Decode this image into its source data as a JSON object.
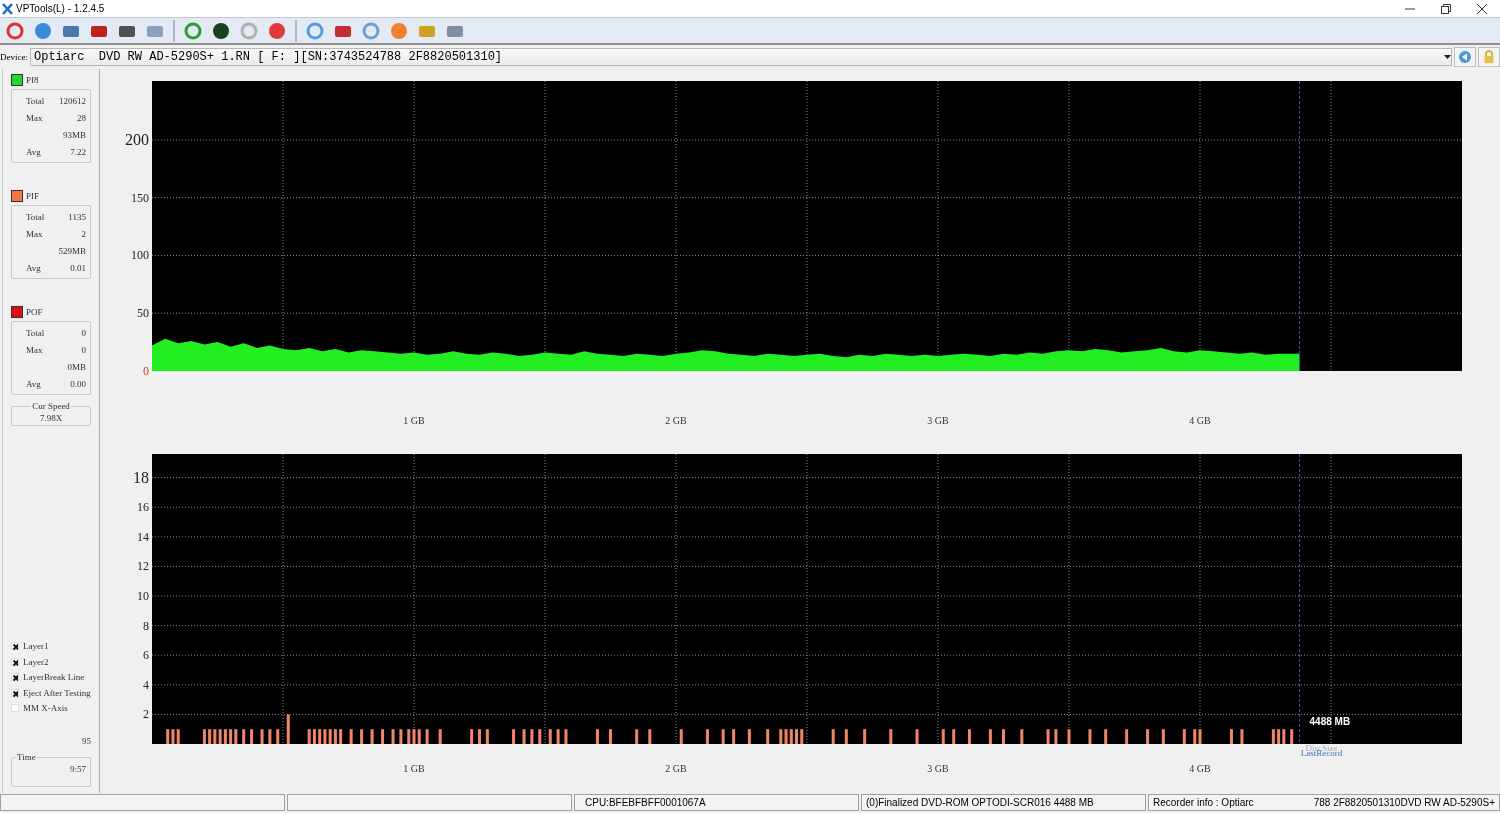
{
  "window": {
    "title": "VPTools(L) - 1.2.4.5"
  },
  "device": {
    "label": "Device:",
    "value": "Optiarc  DVD RW AD-5290S+ 1.RN [ F: ][SN:3743524788 2F8820501310]"
  },
  "stats": [
    {
      "name": "PI8",
      "color": "#22dd22",
      "rows": [
        {
          "label": "Total",
          "value": "120612"
        },
        {
          "label": "Max",
          "value": "28"
        },
        {
          "value": "93MB"
        },
        {
          "label": "Avg",
          "value": "7.22"
        }
      ]
    },
    {
      "name": "PIF",
      "color": "#f07840",
      "rows": [
        {
          "label": "Total",
          "value": "1135"
        },
        {
          "label": "Max",
          "value": "2"
        },
        {
          "value": "529MB"
        },
        {
          "label": "Avg",
          "value": "0.01"
        }
      ]
    },
    {
      "name": "POF",
      "color": "#dd1111",
      "rows": [
        {
          "label": "Total",
          "value": "0"
        },
        {
          "label": "Max",
          "value": "0"
        },
        {
          "value": "0MB"
        },
        {
          "label": "Avg",
          "value": "0.00"
        }
      ]
    }
  ],
  "cur_speed": {
    "label": "Cur Speed",
    "value": "7.98X"
  },
  "options": [
    {
      "label": "Layer1",
      "checked": true
    },
    {
      "label": "Layer2",
      "checked": true
    },
    {
      "label": "LayerBreak Line",
      "checked": true
    },
    {
      "label": "Eject After Testing",
      "checked": true
    },
    {
      "label": "MM X-Axis",
      "checked": false
    }
  ],
  "count": "95",
  "time": {
    "label": "Time",
    "value": "9:57"
  },
  "charts": [
    {
      "chart_data": {
        "type": "area",
        "xlim": [
          0,
          5
        ],
        "ylim": [
          0,
          251
        ],
        "xticks": [
          {
            "value": 1,
            "label": "1 GB"
          },
          {
            "value": 2,
            "label": "2 GB"
          },
          {
            "value": 3,
            "label": "3 GB"
          },
          {
            "value": 4,
            "label": "4 GB"
          }
        ],
        "yticks": [
          0,
          50,
          100,
          150,
          200
        ],
        "x": [
          0,
          0.05,
          0.1,
          0.15,
          0.2,
          0.25,
          0.3,
          0.35,
          0.4,
          0.45,
          0.5,
          0.55,
          0.6,
          0.65,
          0.7,
          0.75,
          0.8,
          0.85,
          0.9,
          0.95,
          1,
          1.05,
          1.1,
          1.15,
          1.2,
          1.25,
          1.3,
          1.35,
          1.4,
          1.45,
          1.5,
          1.55,
          1.6,
          1.65,
          1.7,
          1.75,
          1.8,
          1.85,
          1.9,
          1.95,
          2,
          2.05,
          2.1,
          2.15,
          2.2,
          2.25,
          2.3,
          2.35,
          2.4,
          2.45,
          2.5,
          2.55,
          2.6,
          2.65,
          2.7,
          2.75,
          2.8,
          2.85,
          2.9,
          2.95,
          3,
          3.05,
          3.1,
          3.15,
          3.2,
          3.25,
          3.3,
          3.35,
          3.4,
          3.45,
          3.5,
          3.55,
          3.6,
          3.65,
          3.7,
          3.75,
          3.8,
          3.85,
          3.9,
          3.95,
          4,
          4.05,
          4.1,
          4.15,
          4.2,
          4.25,
          4.3,
          4.35,
          4.38
        ],
        "series": [
          {
            "color": "#22ee22",
            "values": [
              22,
              28,
              24,
              26,
              23,
              25,
              21,
              24,
              20,
              22,
              19,
              18,
              20,
              17,
              19,
              16,
              18,
              17,
              16,
              15,
              16,
              14,
              15,
              17,
              15,
              14,
              16,
              15,
              13,
              14,
              16,
              15,
              14,
              17,
              15,
              14,
              13,
              15,
              14,
              13,
              15,
              16,
              18,
              17,
              15,
              14,
              13,
              15,
              14,
              13,
              14,
              15,
              13,
              12,
              14,
              13,
              15,
              14,
              13,
              14,
              13,
              14,
              15,
              14,
              13,
              15,
              14,
              16,
              15,
              17,
              18,
              17,
              19,
              18,
              16,
              17,
              18,
              20,
              17,
              16,
              18,
              17,
              16,
              15,
              16,
              14,
              15,
              15,
              15
            ]
          }
        ],
        "grid": true,
        "ref_lines": [
          {
            "axis": "x",
            "value": 4.38,
            "color": "#3050d0"
          }
        ]
      }
    },
    {
      "chart_data": {
        "type": "bar",
        "xlim": [
          0,
          5
        ],
        "ylim": [
          0,
          19.6
        ],
        "xticks": [
          {
            "value": 1,
            "label": "1 GB"
          },
          {
            "value": 2,
            "label": "2 GB"
          },
          {
            "value": 3,
            "label": "3 GB"
          },
          {
            "value": 4,
            "label": "4 GB"
          }
        ],
        "yticks": [
          2,
          4,
          6,
          8,
          10,
          12,
          14,
          16,
          18
        ],
        "x": [
          0.06,
          0.08,
          0.1,
          0.2,
          0.22,
          0.24,
          0.26,
          0.28,
          0.3,
          0.32,
          0.35,
          0.38,
          0.42,
          0.45,
          0.48,
          0.52,
          0.6,
          0.62,
          0.64,
          0.66,
          0.68,
          0.7,
          0.72,
          0.76,
          0.8,
          0.84,
          0.88,
          0.92,
          0.95,
          0.98,
          1,
          1.02,
          1.05,
          1.1,
          1.22,
          1.25,
          1.28,
          1.38,
          1.42,
          1.45,
          1.48,
          1.52,
          1.55,
          1.58,
          1.7,
          1.75,
          1.85,
          1.9,
          2.02,
          2.12,
          2.18,
          2.22,
          2.28,
          2.35,
          2.4,
          2.42,
          2.44,
          2.46,
          2.48,
          2.6,
          2.65,
          2.72,
          2.82,
          2.92,
          3.02,
          3.06,
          3.12,
          3.2,
          3.25,
          3.32,
          3.42,
          3.45,
          3.5,
          3.58,
          3.64,
          3.72,
          3.8,
          3.86,
          3.94,
          3.98,
          4,
          4.12,
          4.16,
          4.28,
          4.3,
          4.32,
          4.35
        ],
        "series": [
          {
            "color": "#f08868",
            "values": [
              1,
              1,
              1,
              1,
              1,
              1,
              1,
              1,
              1,
              1,
              1,
              1,
              1,
              1,
              1,
              2,
              1,
              1,
              1,
              1,
              1,
              1,
              1,
              1,
              1,
              1,
              1,
              1,
              1,
              1,
              1,
              1,
              1,
              1,
              1,
              1,
              1,
              1,
              1,
              1,
              1,
              1,
              1,
              1,
              1,
              1,
              1,
              1,
              1,
              1,
              1,
              1,
              1,
              1,
              1,
              1,
              1,
              1,
              1,
              1,
              1,
              1,
              1,
              1,
              1,
              1,
              1,
              1,
              1,
              1,
              1,
              1,
              1,
              1,
              1,
              1,
              1,
              1,
              1,
              1,
              1,
              1,
              1,
              1,
              1,
              1,
              1
            ]
          }
        ],
        "grid": true,
        "ref_lines": [
          {
            "axis": "x",
            "value": 4.38,
            "color": "#3050d0"
          }
        ],
        "annotations": [
          "4488 MB",
          "DiscSize",
          "LastRecord"
        ]
      }
    }
  ],
  "status_bar": [
    [
      "CPU:BFEBFBFF0001067A"
    ],
    [
      "(0)Finalized  DVD-ROM  OPTODI-SCR016  4488 MB"
    ],
    [
      "Recorder info  : Optiarc",
      "788 2F8820501310DVD RW AD-5290S+"
    ]
  ]
}
